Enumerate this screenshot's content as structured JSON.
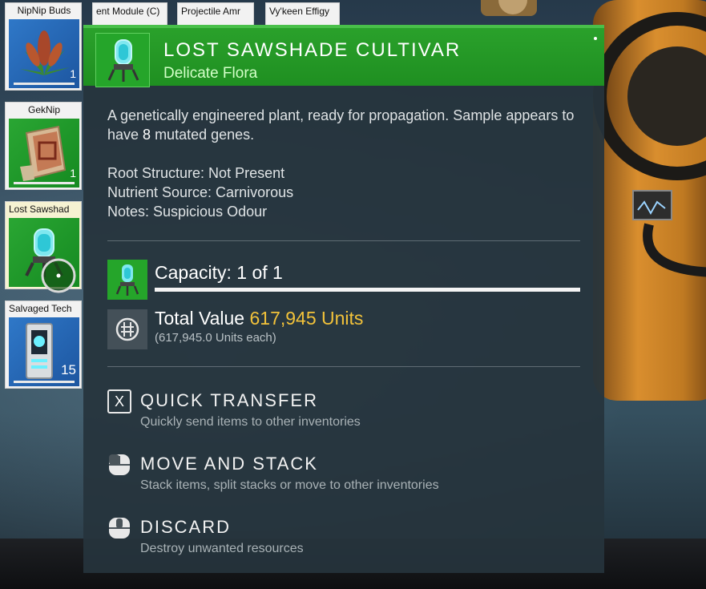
{
  "inventory": {
    "slots": [
      {
        "label": "NipNip Buds",
        "count": "1",
        "icon": "nipnip-buds-icon"
      },
      {
        "label": "GekNip",
        "count": "1",
        "icon": "geknip-icon"
      },
      {
        "label": "Lost Sawshad",
        "count": "",
        "icon": "cultivar-icon"
      },
      {
        "label": "Salvaged Tech",
        "count": "15",
        "icon": "salvaged-tech-icon"
      }
    ],
    "top_slots": [
      {
        "label": "ent Module (C)"
      },
      {
        "label": "Projectile Amr"
      },
      {
        "label": "Vy'keen Effigy"
      }
    ]
  },
  "tooltip": {
    "title": "Lost Sawshade Cultivar",
    "subtitle": "Delicate Flora",
    "description_before": "A genetically engineered plant, ready for propagation. Sample appears to have ",
    "description_highlight": "8",
    "description_after": " mutated genes.",
    "properties": [
      "Root Structure: Not Present",
      "Nutrient Source: Carnivorous",
      "Notes: Suspicious Odour"
    ],
    "capacity_label": "Capacity: 1 of 1",
    "capacity_fraction": 1.0,
    "value_label": "Total Value",
    "value_amount": "617,945 Units",
    "value_each": "(617,945.0 Units each)",
    "actions": [
      {
        "key": "X",
        "title": "Quick Transfer",
        "desc": "Quickly send items to other inventories",
        "icon": "x-key-icon"
      },
      {
        "key": "",
        "title": "Move and Stack",
        "desc": "Stack items, split stacks or move to other inventories",
        "icon": "mouse-left-icon"
      },
      {
        "key": "",
        "title": "Discard",
        "desc": "Destroy unwanted resources",
        "icon": "mouse-middle-icon"
      }
    ]
  },
  "colors": {
    "header_green": "#1f8f21",
    "value_gold": "#f2c23a",
    "panel_bg": "#26343c"
  }
}
